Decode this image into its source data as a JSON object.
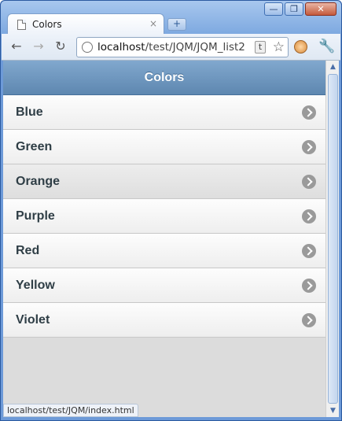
{
  "browser": {
    "tab_title": "Colors",
    "tab_close": "×",
    "new_tab": "+",
    "url_host": "localhost",
    "url_path": "/test/JQM/JQM_list2",
    "badge": "t",
    "status_text": "localhost/test/JQM/index.html",
    "window_buttons": [
      "—",
      "❐",
      "✕"
    ],
    "icons": {
      "back": "←",
      "forward": "→",
      "reload": "↻",
      "star": "☆",
      "wrench": "🔧"
    }
  },
  "page": {
    "header_title": "Colors",
    "items": [
      {
        "label": "Blue"
      },
      {
        "label": "Green"
      },
      {
        "label": "Orange"
      },
      {
        "label": "Purple"
      },
      {
        "label": "Red"
      },
      {
        "label": "Yellow"
      },
      {
        "label": "Violet"
      }
    ]
  },
  "colors": {
    "header_start": "#81a8ce",
    "header_end": "#5e87b0",
    "arrow": "#9a9a9a"
  }
}
